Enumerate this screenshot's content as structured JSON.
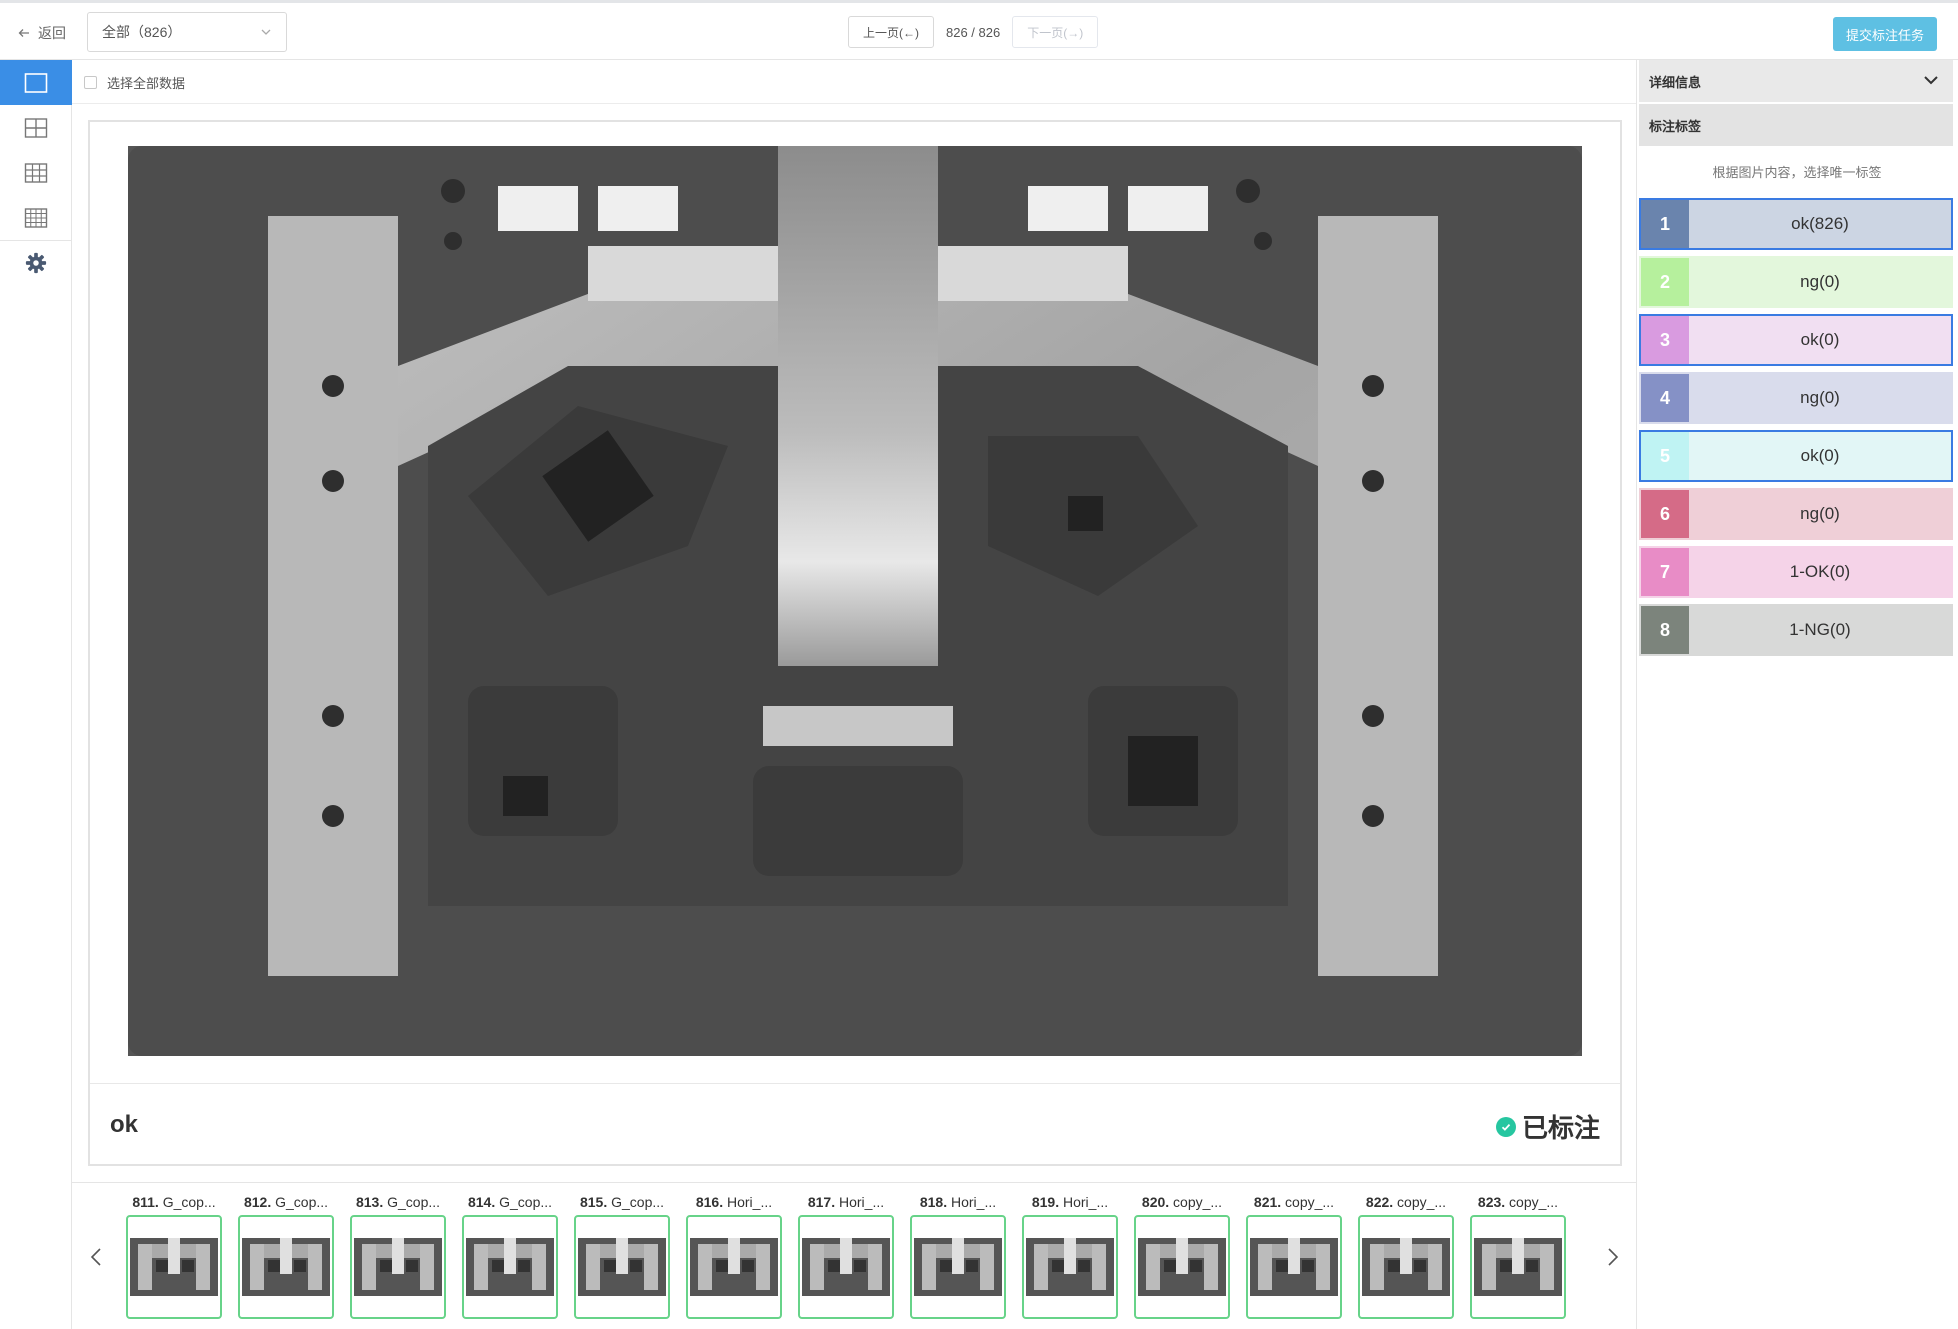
{
  "header": {
    "back_label": "返回",
    "filter_value": "全部（826）",
    "prev_label": "上一页(←)",
    "page_indicator": "826 / 826",
    "next_label": "下一页(→)",
    "submit_label": "提交标注任务"
  },
  "toolbar": {
    "items": [
      "single-view-icon",
      "grid-2x2-icon",
      "grid-3x3-icon",
      "grid-4x4-icon",
      "gear-icon"
    ],
    "active_index": 0
  },
  "main": {
    "select_all_label": "选择全部数据",
    "image_label": "ok",
    "status_label": "已标注"
  },
  "filmstrip": {
    "items": [
      {
        "num": "811.",
        "name": "G_cop..."
      },
      {
        "num": "812.",
        "name": "G_cop..."
      },
      {
        "num": "813.",
        "name": "G_cop..."
      },
      {
        "num": "814.",
        "name": "G_cop..."
      },
      {
        "num": "815.",
        "name": "G_cop..."
      },
      {
        "num": "816.",
        "name": "Hori_..."
      },
      {
        "num": "817.",
        "name": "Hori_..."
      },
      {
        "num": "818.",
        "name": "Hori_..."
      },
      {
        "num": "819.",
        "name": "Hori_..."
      },
      {
        "num": "820.",
        "name": "copy_..."
      },
      {
        "num": "821.",
        "name": "copy_..."
      },
      {
        "num": "822.",
        "name": "copy_..."
      },
      {
        "num": "823.",
        "name": "copy_..."
      }
    ]
  },
  "panel": {
    "details_title": "详细信息",
    "labels_title": "标注标签",
    "hint": "根据图片内容，选择唯一标签",
    "tags": [
      {
        "num": "1",
        "label": "ok(826)",
        "num_color": "#6a84ad",
        "bg": "#ccd5e3",
        "selected": true
      },
      {
        "num": "2",
        "label": "ng(0)",
        "num_color": "#b6f09d",
        "bg": "#e3f7dc",
        "selected": false
      },
      {
        "num": "3",
        "label": "ok(0)",
        "num_color": "#d99be0",
        "bg": "#f1dff2",
        "selected": true
      },
      {
        "num": "4",
        "label": "ng(0)",
        "num_color": "#8591c6",
        "bg": "#d9dcec",
        "selected": false
      },
      {
        "num": "5",
        "label": "ok(0)",
        "num_color": "#bff3f3",
        "bg": "#e2f6f6",
        "selected": true
      },
      {
        "num": "6",
        "label": "ng(0)",
        "num_color": "#d56b87",
        "bg": "#efcfd7",
        "selected": false
      },
      {
        "num": "7",
        "label": "1-OK(0)",
        "num_color": "#e88cc6",
        "bg": "#f5d3e8",
        "selected": false
      },
      {
        "num": "8",
        "label": "1-NG(0)",
        "num_color": "#7c847c",
        "bg": "#d8d9d8",
        "selected": false
      }
    ]
  }
}
